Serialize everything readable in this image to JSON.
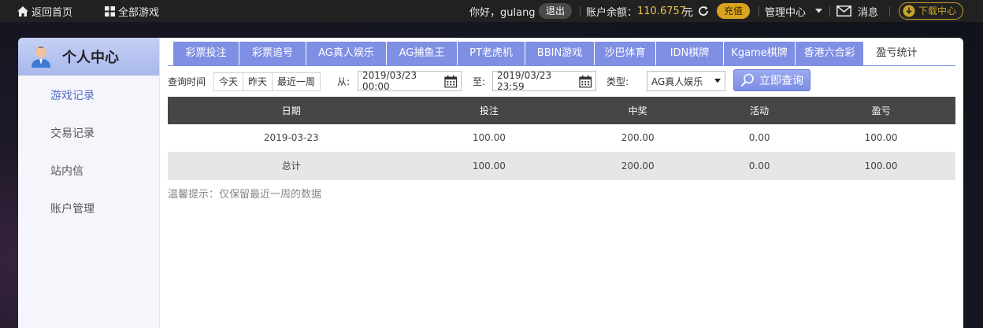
{
  "topbar": {
    "home": "返回首页",
    "all_games": "全部游戏",
    "greeting": "你好，gulang",
    "logout": "退出",
    "balance_label": "账户余额：",
    "balance_value": "110.6757",
    "currency": "元",
    "recharge": "充值",
    "manage": "管理中心",
    "messages": "消息",
    "download": "下载中心",
    "colors": {
      "bar": "#212121",
      "balance": "#e8c44a",
      "gold": "#d9a520"
    }
  },
  "sidebar": {
    "title": "个人中心",
    "items": [
      {
        "label": "游戏记录",
        "active": true
      },
      {
        "label": "交易记录",
        "active": false
      },
      {
        "label": "站内信",
        "active": false
      },
      {
        "label": "账户管理",
        "active": false
      }
    ]
  },
  "tabs": [
    {
      "label": "彩票投注"
    },
    {
      "label": "彩票追号"
    },
    {
      "label": "AG真人娱乐"
    },
    {
      "label": "AG捕鱼王"
    },
    {
      "label": "PT老虎机"
    },
    {
      "label": "BBIN游戏"
    },
    {
      "label": "沙巴体育"
    },
    {
      "label": "IDN棋牌"
    },
    {
      "label": "Kgame棋牌"
    },
    {
      "label": "香港六合彩"
    },
    {
      "label": "盈亏统计",
      "active": true
    }
  ],
  "query": {
    "time_label": "查询时间",
    "quick": [
      "今天",
      "昨天",
      "最近一周"
    ],
    "from_label": "从:",
    "from_value": "2019/03/23 00:00",
    "to_label": "至:",
    "to_value": "2019/03/23 23:59",
    "type_label": "类型:",
    "type_value": "AG真人娱乐",
    "search_button": "立即查询"
  },
  "table": {
    "headers": [
      "日期",
      "投注",
      "中奖",
      "活动",
      "盈亏"
    ],
    "rows": [
      [
        "2019-03-23",
        "100.00",
        "200.00",
        "0.00",
        "100.00"
      ],
      [
        "总计",
        "100.00",
        "200.00",
        "0.00",
        "100.00"
      ]
    ]
  },
  "note": "温馨提示：仅保留最近一周的数据",
  "accent_color": "#7f8fe4"
}
